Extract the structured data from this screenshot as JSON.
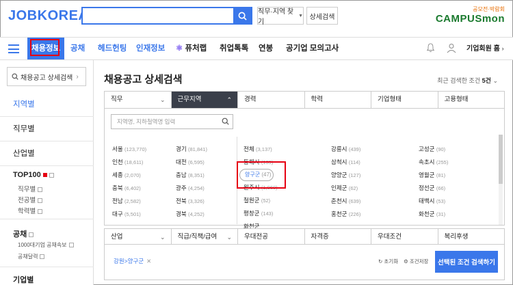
{
  "header": {
    "logo": "JOBKOREA",
    "search_placeholder": "",
    "search_value": "",
    "job_region_button": "직무·지역 찾기",
    "detail_search_button": "상세검색",
    "campus_sub": "공모전·박람회",
    "campus_name": "CAMPUSmon"
  },
  "nav": {
    "items": [
      "채용정보",
      "공채",
      "헤드헌팅",
      "인재정보",
      "퓨처랩",
      "취업톡톡",
      "연봉",
      "공기업 모의고사"
    ],
    "company_home": "기업회원 홈"
  },
  "sidebar": {
    "search_button": "채용공고 상세검색",
    "items": [
      "지역별",
      "직무별",
      "산업별"
    ],
    "top100": "TOP100",
    "top100_sub": [
      "직무별",
      "전공별",
      "학력별"
    ],
    "gongchae": "공채",
    "gongchae_sub": [
      "1000대기업 공채속보",
      "공채달력"
    ],
    "company": "기업별"
  },
  "main": {
    "title": "채용공고 상세검색",
    "recent_label": "최근 검색한 조건",
    "recent_count": "5건",
    "tabs": [
      "직무",
      "근무지역",
      "경력",
      "학력",
      "기업형태",
      "고용형태"
    ],
    "region_search_placeholder": "지역명, 지하철역명 입력",
    "regions_left": [
      {
        "name": "서울",
        "count": "(123,770)"
      },
      {
        "name": "인천",
        "count": "(18,611)"
      },
      {
        "name": "세종",
        "count": "(2,070)"
      },
      {
        "name": "충북",
        "count": "(6,402)"
      },
      {
        "name": "전남",
        "count": "(2,582)"
      },
      {
        "name": "대구",
        "count": "(5,501)"
      }
    ],
    "regions_left2": [
      {
        "name": "경기",
        "count": "(81,841)"
      },
      {
        "name": "대전",
        "count": "(6,595)"
      },
      {
        "name": "충남",
        "count": "(8,351)"
      },
      {
        "name": "광주",
        "count": "(4,254)"
      },
      {
        "name": "전북",
        "count": "(3,326)"
      },
      {
        "name": "경북",
        "count": "(4,252)"
      }
    ],
    "cities_col1": [
      {
        "name": "전체",
        "count": "(3,137)"
      },
      {
        "name": "동해시",
        "count": "(139)"
      },
      {
        "name": "양구군",
        "count": "(47)"
      },
      {
        "name": "원주시",
        "count": "(1,060)"
      },
      {
        "name": "철원군",
        "count": "(52)"
      },
      {
        "name": "평창군",
        "count": "(143)"
      },
      {
        "name": "화천군",
        "count": ""
      }
    ],
    "cities_col2": [
      {
        "name": "강릉시",
        "count": "(439)"
      },
      {
        "name": "삼척시",
        "count": "(114)"
      },
      {
        "name": "양양군",
        "count": "(127)"
      },
      {
        "name": "인제군",
        "count": "(62)"
      },
      {
        "name": "춘천시",
        "count": "(639)"
      },
      {
        "name": "홍천군",
        "count": "(226)"
      }
    ],
    "cities_col3": [
      {
        "name": "고성군",
        "count": "(90)"
      },
      {
        "name": "속초시",
        "count": "(255)"
      },
      {
        "name": "영월군",
        "count": "(81)"
      },
      {
        "name": "정선군",
        "count": "(66)"
      },
      {
        "name": "태백시",
        "count": "(53)"
      },
      {
        "name": "화천군",
        "count": "(31)"
      }
    ],
    "tabs2": [
      "산업",
      "직급/직책/급여",
      "우대전공",
      "자격증",
      "우대조건",
      "복리후생"
    ],
    "selected_tag": "강원>양구군",
    "reset": "초기화",
    "save": "조건저장",
    "submit": "선택된 조건 검색하기"
  },
  "colors": {
    "accent": "#3a77ea",
    "highlight": "#e60012",
    "dark_tab": "#3a3f4a"
  }
}
